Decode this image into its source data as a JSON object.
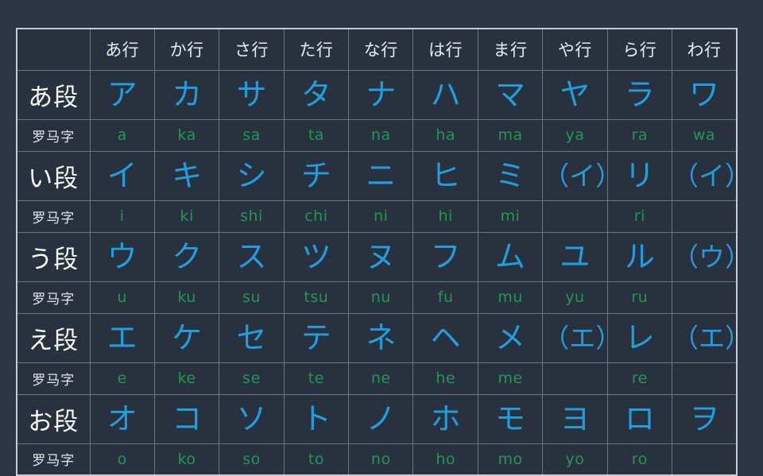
{
  "chart": {
    "title": "",
    "corner_label": "",
    "column_headers": [
      "あ行",
      "か行",
      "さ行",
      "た行",
      "な行",
      "は行",
      "ま行",
      "や行",
      "ら行",
      "わ行"
    ],
    "romaji_label": "罗马字",
    "rows": [
      {
        "label": "あ段",
        "kana": [
          "ア",
          "カ",
          "サ",
          "タ",
          "ナ",
          "ハ",
          "マ",
          "ヤ",
          "ラ",
          "ワ"
        ],
        "romaji": [
          "a",
          "ka",
          "sa",
          "ta",
          "na",
          "ha",
          "ma",
          "ya",
          "ra",
          "wa"
        ]
      },
      {
        "label": "い段",
        "kana": [
          "イ",
          "キ",
          "シ",
          "チ",
          "ニ",
          "ヒ",
          "ミ",
          "（イ）",
          "リ",
          "（イ）"
        ],
        "romaji": [
          "i",
          "ki",
          "shi",
          "chi",
          "ni",
          "hi",
          "mi",
          "",
          "ri",
          ""
        ]
      },
      {
        "label": "う段",
        "kana": [
          "ウ",
          "ク",
          "ス",
          "ツ",
          "ヌ",
          "フ",
          "ム",
          "ユ",
          "ル",
          "（ウ）"
        ],
        "romaji": [
          "u",
          "ku",
          "su",
          "tsu",
          "nu",
          "fu",
          "mu",
          "yu",
          "ru",
          ""
        ]
      },
      {
        "label": "え段",
        "kana": [
          "エ",
          "ケ",
          "セ",
          "テ",
          "ネ",
          "ヘ",
          "メ",
          "（エ）",
          "レ",
          "（エ）"
        ],
        "romaji": [
          "e",
          "ke",
          "se",
          "te",
          "ne",
          "he",
          "me",
          "",
          "re",
          ""
        ]
      },
      {
        "label": "お段",
        "kana": [
          "オ",
          "コ",
          "ソ",
          "ト",
          "ノ",
          "ホ",
          "モ",
          "ヨ",
          "ロ",
          "ヲ"
        ],
        "romaji": [
          "o",
          "ko",
          "so",
          "to",
          "no",
          "ho",
          "mo",
          "yo",
          "ro",
          ""
        ]
      }
    ],
    "colors": {
      "page_background": "#2b3543",
      "cell_background": "#28313d",
      "outer_border": "#c9ccd1",
      "inner_border": "#6b7682",
      "kana_text": "#1f9ee0",
      "romaji_text": "#1f9a55",
      "header_text": "#e9ecef",
      "row_label_text": "#ffffff"
    }
  }
}
